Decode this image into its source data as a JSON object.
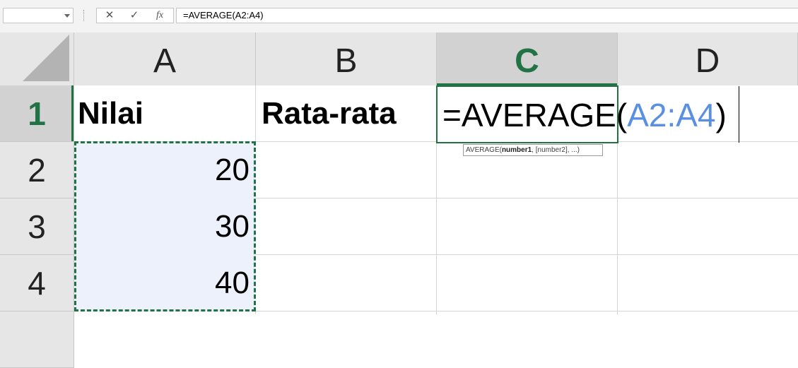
{
  "formula_bar": {
    "name_box": "",
    "cancel_icon": "close-icon",
    "enter_icon": "check-icon",
    "fx_label": "fx",
    "formula": "=AVERAGE(A2:A4)"
  },
  "columns": [
    "A",
    "B",
    "C",
    "D"
  ],
  "rows": [
    "1",
    "2",
    "3",
    "4"
  ],
  "cells": {
    "A1": "Nilai",
    "B1": "Rata-rata",
    "A2": "20",
    "A3": "30",
    "A4": "40"
  },
  "editing": {
    "prefix": "=AVERAGE(",
    "ref": "A2:A4",
    "suffix": ")"
  },
  "tooltip": {
    "fn": "AVERAGE(",
    "arg1": "number1",
    "rest": ", [number2], ...)"
  },
  "colors": {
    "accent": "#217346",
    "ref_color": "#5b8fe3",
    "range_fill": "#edf1fb"
  }
}
